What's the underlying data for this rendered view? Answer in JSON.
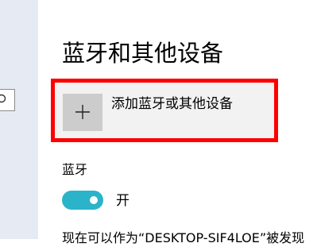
{
  "page": {
    "title": "蓝牙和其他设备"
  },
  "add_device": {
    "label": "添加蓝牙或其他设备",
    "icon": "plus-icon"
  },
  "bluetooth": {
    "heading": "蓝牙",
    "toggle_on": true,
    "toggle_label": "开",
    "discoverable_text": "现在可以作为“DESKTOP-SIF4LOE”被发现"
  },
  "sidebar": {
    "search_icon": "search-icon"
  },
  "colors": {
    "sidebar_bg": "#e6ebf3",
    "tile_bg": "#f2f2f2",
    "plus_tile_bg": "#cccccc",
    "highlight_border": "#ff0000",
    "toggle_on": "#2bb3c9"
  }
}
